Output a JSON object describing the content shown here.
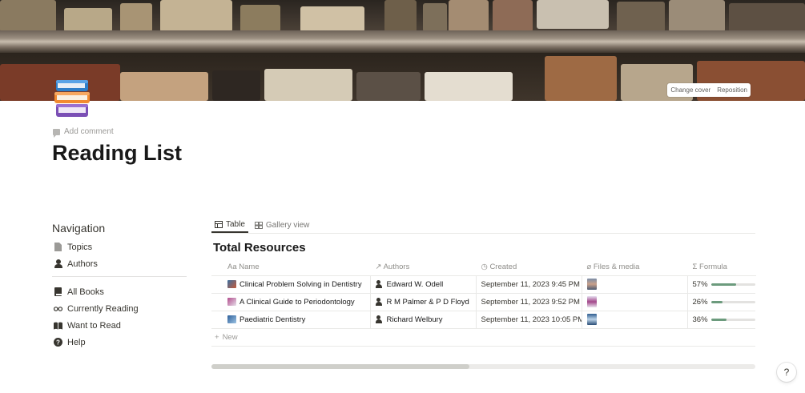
{
  "cover": {
    "change_cover": "Change cover",
    "reposition": "Reposition"
  },
  "page": {
    "add_comment": "Add comment",
    "title": "Reading List"
  },
  "navigation": {
    "heading": "Navigation",
    "group1": [
      {
        "label": "Topics",
        "icon": "document-icon"
      },
      {
        "label": "Authors",
        "icon": "person-icon"
      }
    ],
    "group2": [
      {
        "label": "All Books",
        "icon": "book-icon"
      },
      {
        "label": "Currently Reading",
        "icon": "glasses-icon"
      },
      {
        "label": "Want to Read",
        "icon": "open-book-icon"
      },
      {
        "label": "Help",
        "icon": "question-icon"
      }
    ]
  },
  "database": {
    "tabs": [
      {
        "label": "Table",
        "active": true
      },
      {
        "label": "Gallery view",
        "active": false
      }
    ],
    "title": "Total Resources",
    "columns": [
      {
        "label": "Name",
        "prefix": "Aa"
      },
      {
        "label": "Authors",
        "prefix": "↗"
      },
      {
        "label": "Created",
        "prefix": "◷"
      },
      {
        "label": "Files & media",
        "prefix": "⌀"
      },
      {
        "label": "Formula",
        "prefix": "Σ"
      }
    ],
    "rows": [
      {
        "name": "Clinical Problem Solving in Dentistry",
        "author": "Edward W. Odell",
        "created": "September 11, 2023 9:45 PM",
        "formula": "57%",
        "progress": 0.57
      },
      {
        "name": "A Clinical Guide to Periodontology",
        "author": "R M Palmer & P D Floyd",
        "created": "September 11, 2023 9:52 PM",
        "formula": "26%",
        "progress": 0.26
      },
      {
        "name": "Paediatric Dentistry",
        "author": "Richard Welbury",
        "created": "September 11, 2023 10:05 PM",
        "formula": "36%",
        "progress": 0.36
      }
    ],
    "new_label": "New"
  },
  "help_button": "?",
  "colors": {
    "progress_fill": "#6c9b7d",
    "text": "#37352f"
  }
}
